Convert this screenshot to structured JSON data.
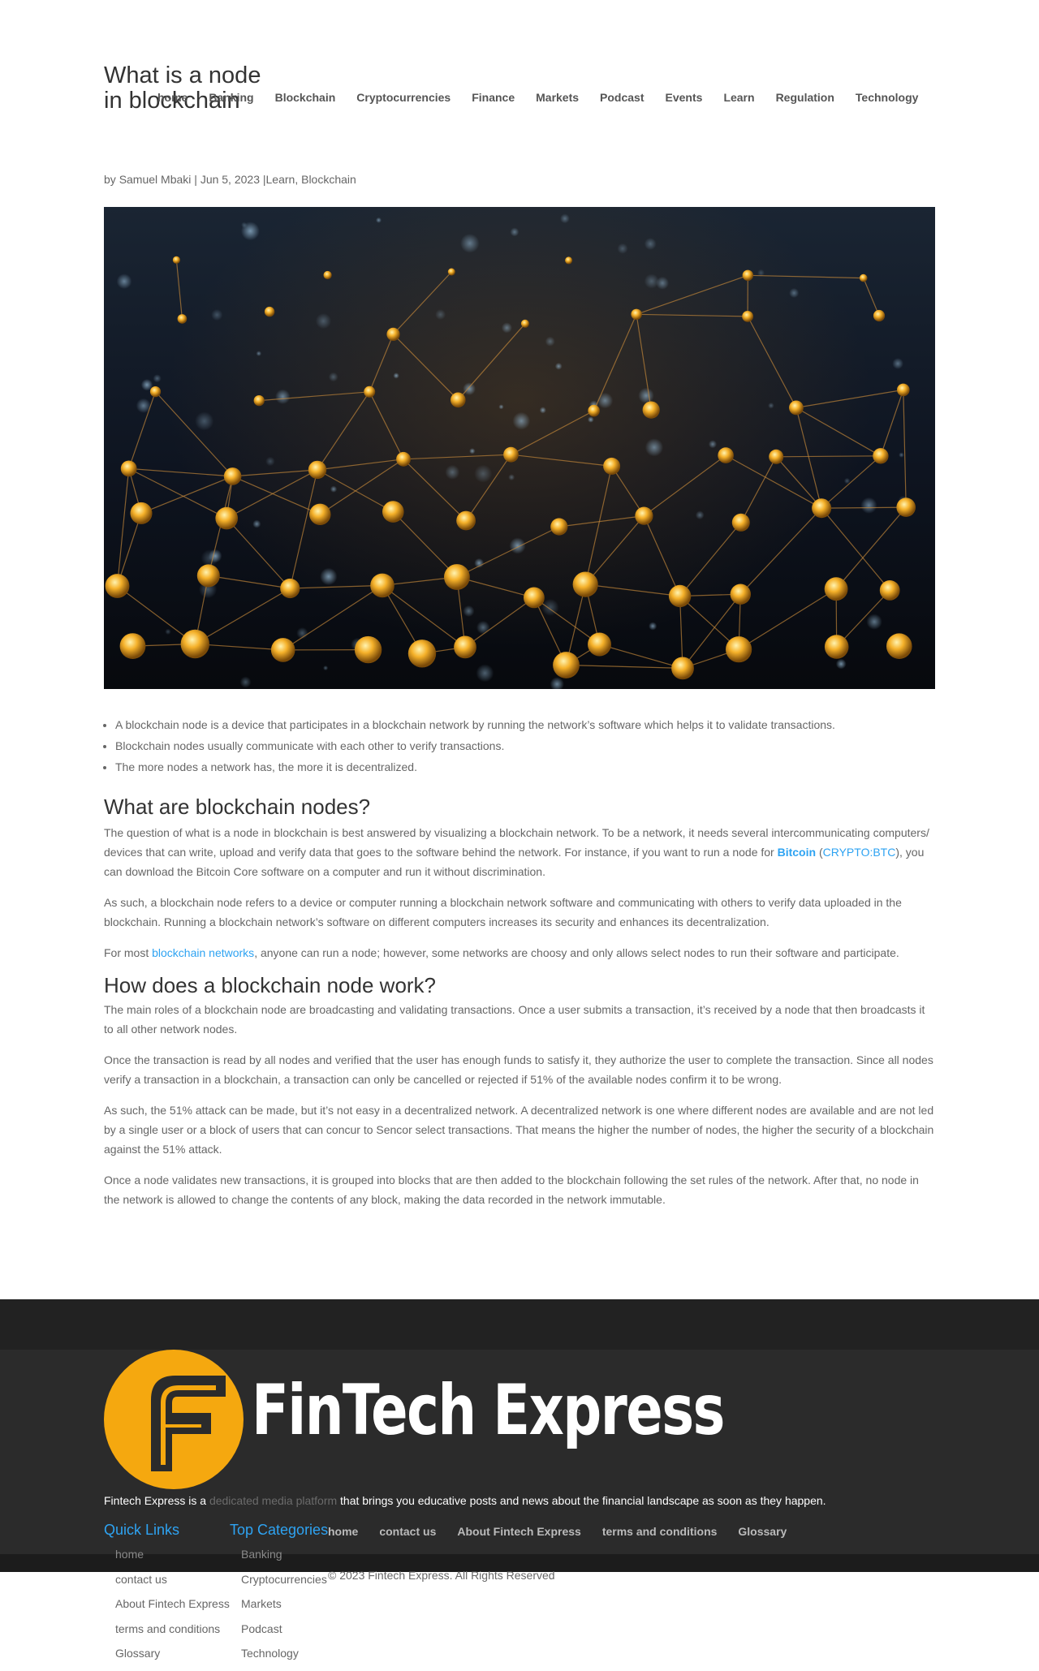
{
  "header": {
    "title": "What is a node in blockchain",
    "nav": [
      "home",
      "Banking",
      "Blockchain",
      "Cryptocurrencies",
      "Finance",
      "Markets",
      "Podcast",
      "Events",
      "Learn",
      "Regulation",
      "Technology"
    ]
  },
  "meta": {
    "by": "by",
    "author": "Samuel Mbaki",
    "sep1": "|",
    "date": "Jun 5, 2023",
    "sep2": "|",
    "cat1": "Learn",
    "comma": ",",
    "cat2": "Blockchain"
  },
  "hero": {
    "alt": "Glowing golden nodes connected in a network"
  },
  "key_points": [
    "A blockchain node is a device that participates in a blockchain network by running the network’s software which helps it to validate transactions.",
    "Blockchain nodes usually communicate with each other to verify transactions.",
    "The more nodes a network has, the more it is decentralized."
  ],
  "section1": {
    "heading": "What are blockchain nodes?",
    "p1_a": "The question of what is a node in blockchain is best answered by visualizing a blockchain network. To be a network, it needs several intercommunicating computers/ devices that can write, upload and verify data that goes to the software behind the network. For instance, if you want to run a node for ",
    "p1_link1": "Bitcoin",
    "p1_b": " (",
    "p1_link2": "CRYPTO:BTC",
    "p1_c": "), you can download the Bitcoin Core software on a computer and run it without discrimination.",
    "p2": "As such, a blockchain node refers to a device or computer running a blockchain network software and communicating with others to verify data uploaded in the blockchain. Running a blockchain network’s software on different computers increases its security and enhances its decentralization.",
    "p3_a": "For most ",
    "p3_link": "blockchain networks",
    "p3_b": ", anyone can run a node; however, some networks are choosy and only allows select nodes to run their software and participate."
  },
  "section2": {
    "heading": "How does a blockchain node work?",
    "p1": "The main roles of a blockchain node are broadcasting and validating transactions. Once a user submits a transaction, it’s received by a node that then broadcasts it to all other network nodes.",
    "p2": "Once the transaction is read by all nodes and verified that the user has enough funds to satisfy it, they authorize the user to complete the transaction. Since all nodes verify a transaction in a blockchain, a transaction can only be cancelled or rejected if 51% of the available nodes confirm it to be wrong.",
    "p3": "As such, the 51% attack can be made, but it’s not easy in a decentralized network. A decentralized network is one where different nodes are available and are not led by a single user or a block of users that can concur to Sencor select transactions. That means the higher the number of nodes, the higher the security of a blockchain against the 51% attack.",
    "p4": "Once a node validates new transactions, it is grouped into blocks that are then added to the blockchain following the set rules of the network. After that, no node in the network is allowed to change the contents of any block, making the data recorded in the network immutable."
  },
  "footer": {
    "brand": "FinTech Express",
    "about_a": "Fintech Express is a ",
    "about_link": "dedicated media platform",
    "about_b": " that brings you educative posts and news about the financial landscape as soon as they happen.",
    "quick_links_title": "Quick Links",
    "quick_links": [
      "home",
      "contact us",
      "About Fintech Express",
      "terms and conditions",
      "Glossary"
    ],
    "top_categories_title": "Top Categories",
    "top_categories": [
      "Banking",
      "Cryptocurrencies",
      "Markets",
      "Podcast",
      "Technology"
    ],
    "bottom_nav": [
      "home",
      "contact us",
      "About Fintech Express",
      "terms and conditions",
      "Glossary"
    ],
    "copyright": "© 2023 Fintech Express. All Rights Reserved"
  },
  "colors": {
    "accent": "#2ea3f2",
    "brand_yellow": "#f5a80f",
    "footer_bg": "#2b2b2b"
  }
}
